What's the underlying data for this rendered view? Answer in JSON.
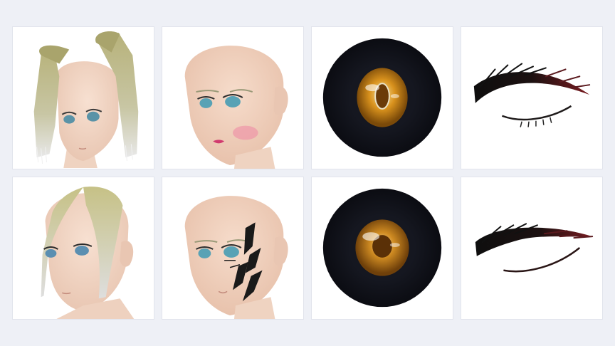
{
  "colors": {
    "background": "#eef0f6",
    "tile_background": "#ffffff",
    "skin": "#f3d6c4",
    "hair_blonde": "#b9b57e",
    "hair_silver": "#dcdcdc",
    "eye_amber": "#d58f1e",
    "eye_outer": "#0f1118",
    "lash_black": "#111111",
    "lash_red": "#6b1a1f"
  },
  "gallery": {
    "items": [
      {
        "id": "hair-twin-tails",
        "kind": "hair",
        "icon": "hair-style-icon"
      },
      {
        "id": "face-makeup",
        "kind": "face",
        "icon": "face-makeup-icon"
      },
      {
        "id": "eye-iris-1",
        "kind": "eye",
        "icon": "iris-icon"
      },
      {
        "id": "eyelash-1",
        "kind": "eyelash",
        "icon": "eyelash-icon"
      },
      {
        "id": "hair-side-bang",
        "kind": "hair",
        "icon": "hair-style-icon"
      },
      {
        "id": "face-tattoo",
        "kind": "face",
        "icon": "face-tattoo-icon"
      },
      {
        "id": "eye-iris-2",
        "kind": "eye",
        "icon": "iris-icon"
      },
      {
        "id": "eyelash-2",
        "kind": "eyelash",
        "icon": "eyelash-icon"
      }
    ]
  }
}
